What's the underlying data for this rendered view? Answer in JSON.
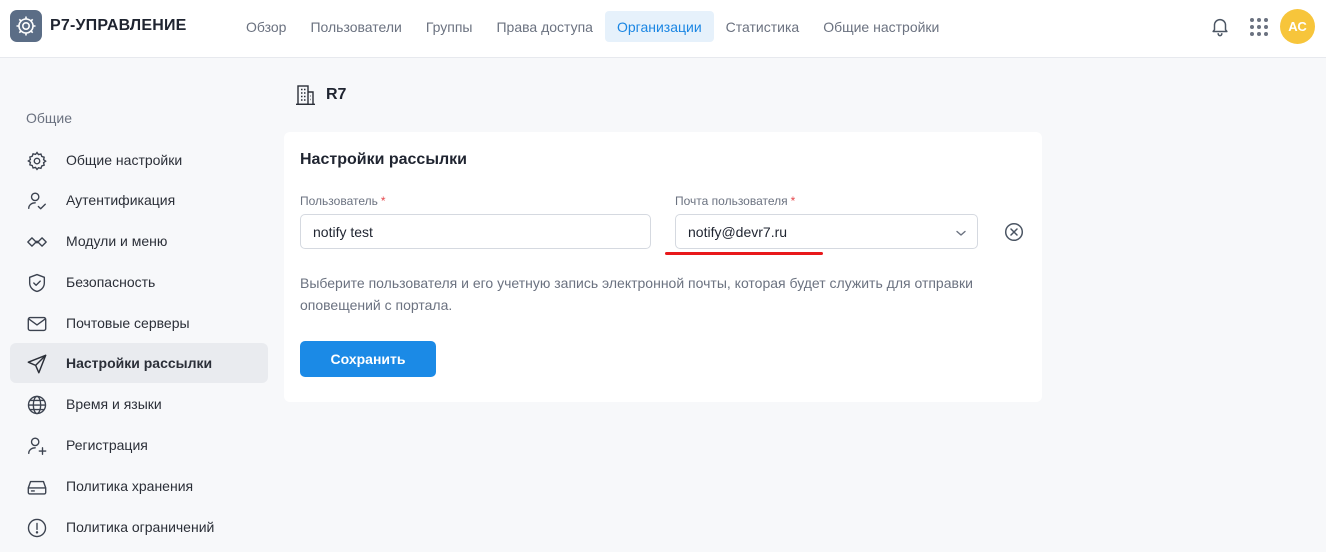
{
  "header": {
    "brand": "Р7-УПРАВЛЕНИЕ",
    "nav": [
      {
        "label": "Обзор",
        "active": false
      },
      {
        "label": "Пользователи",
        "active": false
      },
      {
        "label": "Группы",
        "active": false
      },
      {
        "label": "Права доступа",
        "active": false
      },
      {
        "label": "Организации",
        "active": true
      },
      {
        "label": "Статистика",
        "active": false
      },
      {
        "label": "Общие настройки",
        "active": false
      }
    ],
    "avatar_initials": "АС",
    "avatar_color": "#f7c53b",
    "accent_color": "#1b86e3"
  },
  "sidebar": {
    "section_title": "Общие",
    "items": [
      {
        "label": "Общие настройки",
        "icon": "gear-icon"
      },
      {
        "label": "Аутентификация",
        "icon": "user-check-icon"
      },
      {
        "label": "Модули и меню",
        "icon": "modules-icon"
      },
      {
        "label": "Безопасность",
        "icon": "shield-check-icon"
      },
      {
        "label": "Почтовые серверы",
        "icon": "mail-icon"
      },
      {
        "label": "Настройки рассылки",
        "icon": "send-icon",
        "active": true
      },
      {
        "label": "Время и языки",
        "icon": "globe-icon"
      },
      {
        "label": "Регистрация",
        "icon": "user-plus-icon"
      },
      {
        "label": "Политика хранения",
        "icon": "storage-icon"
      },
      {
        "label": "Политика ограничений",
        "icon": "alert-circle-icon"
      }
    ]
  },
  "page": {
    "org_name": "R7"
  },
  "card": {
    "title": "Настройки рассылки",
    "user_field": {
      "label": "Пользователь",
      "required_mark": "*",
      "value": "notify test"
    },
    "email_field": {
      "label": "Почта пользователя",
      "required_mark": "*",
      "value": "notify@devr7.ru"
    },
    "hint": "Выберите пользователя и его учетную запись электронной почты, которая будет служить для отправки оповещений с портала.",
    "save_label": "Сохранить"
  }
}
